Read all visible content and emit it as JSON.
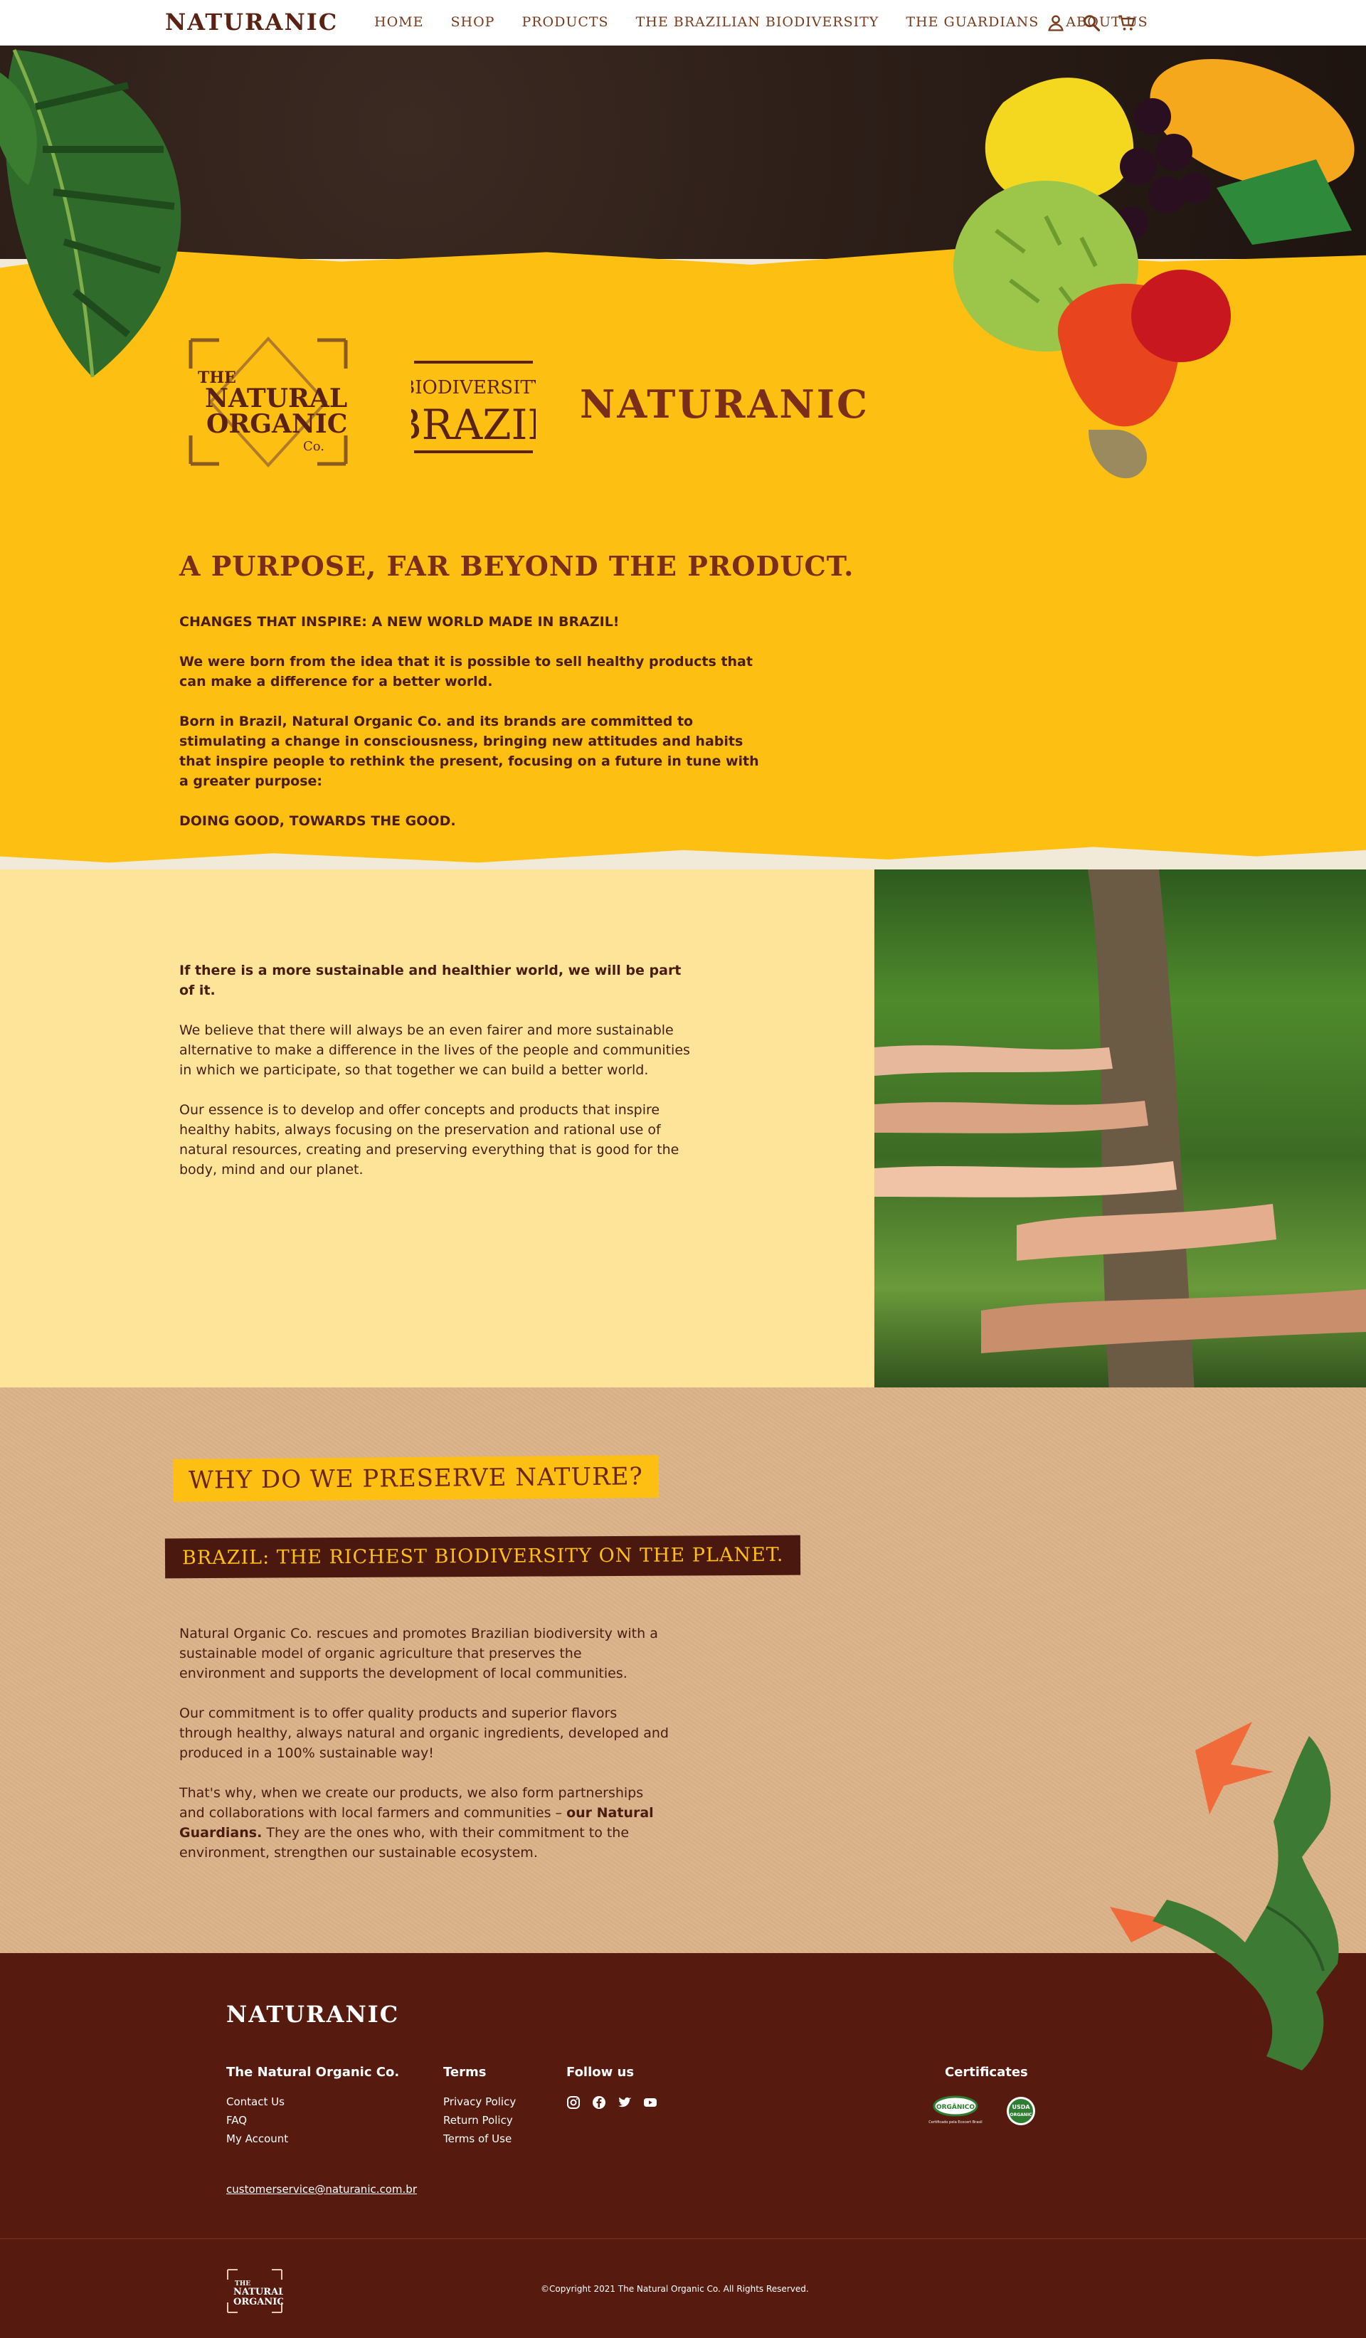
{
  "header": {
    "logo": "NATURANIC",
    "nav": [
      "HOME",
      "SHOP",
      "PRODUCTS",
      "THE BRAZILIAN BIODIVERSITY",
      "THE GUARDIANS",
      "ABOUT US"
    ],
    "icons": [
      "user-icon",
      "search-icon",
      "cart-icon"
    ]
  },
  "brands": {
    "tno_line1": "THE",
    "tno_line2": "NATURAL",
    "tno_line3": "ORGANIC",
    "tno_line4": "Co.",
    "bio_line1": "BIODIVERSITY",
    "bio_line2": "BRAZIL",
    "naturanic": "NATURANIC"
  },
  "purpose": {
    "title": "A PURPOSE, FAR BEYOND THE PRODUCT.",
    "headline": "CHANGES THAT INSPIRE: A NEW WORLD MADE IN BRAZIL!",
    "p1": "We were born from the idea that it is possible to sell healthy products that can make a difference for a better world.",
    "p2": "Born in Brazil, Natural Organic Co. and its brands are committed to stimulating a change in consciousness, bringing new attitudes and habits that inspire people to rethink the present, focusing on a future in tune with a greater purpose:",
    "closing": "DOING GOOD, TOWARDS THE GOOD."
  },
  "sustainable": {
    "headline": "If there is a more sustainable and healthier world, we will be part of it.",
    "p1": "We believe that there will always be an even fairer and more sustainable alternative to make a difference in the lives of the people and communities in which we participate, so that together we can build a better world.",
    "p2": "Our essence is to develop and offer concepts and products that inspire healthy habits, always focusing on the preservation and rational use of natural resources, creating and preserving everything that is good for the body, mind and our planet."
  },
  "preserve": {
    "title": "WHY DO WE PRESERVE NATURE?",
    "subtitle": "BRAZIL: THE RICHEST BIODIVERSITY ON THE PLANET.",
    "p1": "Natural Organic Co. rescues and promotes Brazilian biodiversity with a sustainable model of organic agriculture that preserves the environment and supports the development of local communities.",
    "p2": "Our commitment is to offer quality products and superior flavors through healthy, always natural and organic ingredients, developed and produced in a 100% sustainable way!",
    "p3_start": "That's why, when we create our products, we also form partnerships and collaborations with local farmers and communities – ",
    "p3_bold": "our Natural Guardians.",
    "p3_end": " They are the ones who, with their commitment to the environment, strengthen our sustainable ecosystem."
  },
  "footer": {
    "logo": "NATURANIC",
    "col1_title": "The Natural Organic Co.",
    "col1_links": [
      "Contact Us",
      "FAQ",
      "My Account"
    ],
    "col2_title": "Terms",
    "col2_links": [
      "Privacy Policy",
      "Return Policy",
      "Terms of Use"
    ],
    "col3_title": "Follow us",
    "social_icons": [
      "instagram-icon",
      "facebook-icon",
      "twitter-icon",
      "youtube-icon"
    ],
    "cert_title": "Certificates",
    "cert_badge1": "ORGÂNICO",
    "cert_badge1_caption": "Certificado pela Ecocert Brasil",
    "cert_badge2_line1": "USDA",
    "cert_badge2_line2": "ORGANIC",
    "email": "customerservice@naturanic.com.br",
    "copyright": "©Copyright 2021 The Natural Organic Co. All Rights Reserved.",
    "tno_line1": "THE",
    "tno_line2": "NATURAL",
    "tno_line3": "ORGANIC"
  },
  "colors": {
    "brand_brown": "#561a0f",
    "brand_yellow": "#fcbf12",
    "light_yellow": "#fde498",
    "kraft": "#dcb38a"
  }
}
